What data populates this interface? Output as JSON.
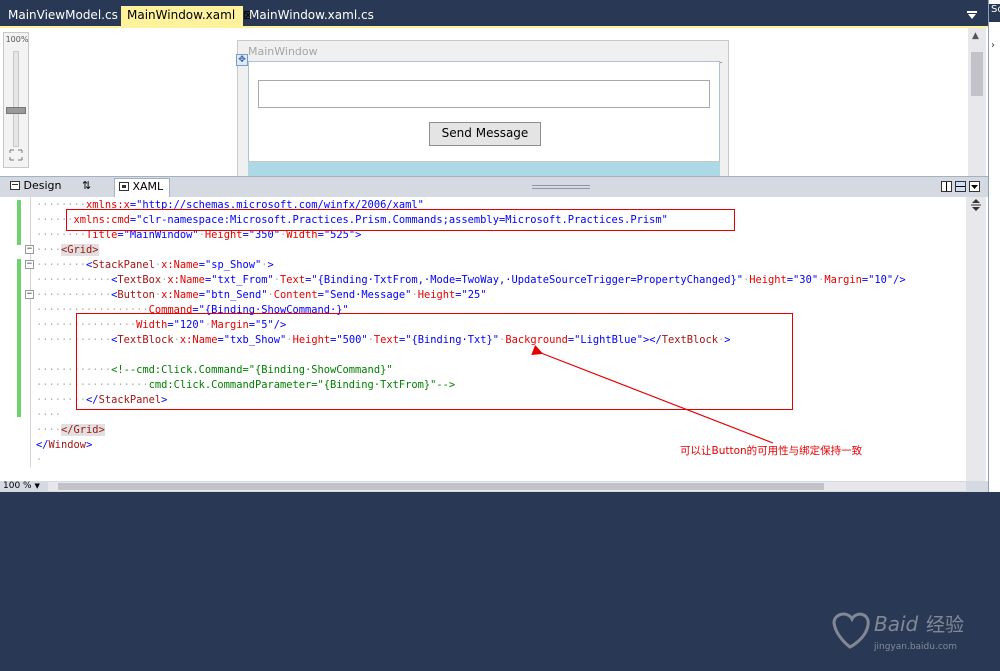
{
  "tabs": [
    {
      "label": "MainViewModel.cs",
      "active": false
    },
    {
      "label": "MainWindow.xaml",
      "active": true,
      "close": "⊠"
    },
    {
      "label": "MainWindow.xaml.cs",
      "active": false
    }
  ],
  "right_panel_label": "So",
  "designer": {
    "zoom_level": "100%",
    "window_title": "MainWindow",
    "button_label": "Send Message",
    "textblock_background": "#add8e6"
  },
  "split_tabs": {
    "design": "Design",
    "swap": "⇅",
    "xaml": "XAML"
  },
  "code_lines": [
    [
      [
        "sp",
        "········"
      ],
      [
        "attr",
        "xmlns:x"
      ],
      [
        "val",
        "=\"http://schemas.microsoft.com/winfx/2006/xaml\""
      ]
    ],
    [
      [
        "sp",
        "······"
      ],
      [
        "attr",
        "xmlns:cmd"
      ],
      [
        "val",
        "=\"clr-namespace:Microsoft.Practices.Prism.Commands;assembly=Microsoft.Practices.Prism\""
      ]
    ],
    [
      [
        "sp",
        "········"
      ],
      [
        "attr",
        "Title"
      ],
      [
        "val",
        "=\"MainWindow\""
      ],
      [
        "sp",
        "·"
      ],
      [
        "attr",
        "Height"
      ],
      [
        "val",
        "=\"350\""
      ],
      [
        "sp",
        "·"
      ],
      [
        "attr",
        "Width"
      ],
      [
        "val",
        "=\"525\">"
      ]
    ],
    [
      [
        "sp",
        "····"
      ],
      [
        "hltag",
        "<Grid>"
      ]
    ],
    [
      [
        "sp",
        "········"
      ],
      [
        "val",
        "<"
      ],
      [
        "tag",
        "StackPanel"
      ],
      [
        "sp",
        "·"
      ],
      [
        "attr",
        "x:Name"
      ],
      [
        "val",
        "=\"sp_Show\""
      ],
      [
        "sp",
        "·"
      ],
      [
        "val",
        ">"
      ]
    ],
    [
      [
        "sp",
        "············"
      ],
      [
        "val",
        "<"
      ],
      [
        "tag",
        "TextBox"
      ],
      [
        "sp",
        "·"
      ],
      [
        "attr",
        "x:Name"
      ],
      [
        "val",
        "=\"txt_From\""
      ],
      [
        "sp",
        "·"
      ],
      [
        "attr",
        "Text"
      ],
      [
        "val",
        "=\"{Binding·TxtFrom,·Mode=TwoWay,·UpdateSourceTrigger=PropertyChanged}\""
      ],
      [
        "sp",
        "·"
      ],
      [
        "attr",
        "Height"
      ],
      [
        "val",
        "=\"30\""
      ],
      [
        "sp",
        "·"
      ],
      [
        "attr",
        "Margin"
      ],
      [
        "val",
        "=\"10\"/>"
      ]
    ],
    [
      [
        "sp",
        "············"
      ],
      [
        "val",
        "<"
      ],
      [
        "tag",
        "Button"
      ],
      [
        "sp",
        "·"
      ],
      [
        "attr",
        "x:Name"
      ],
      [
        "val",
        "=\"btn_Send\""
      ],
      [
        "sp",
        "·"
      ],
      [
        "attr",
        "Content"
      ],
      [
        "val",
        "=\"Send·Message\""
      ],
      [
        "sp",
        "·"
      ],
      [
        "attr",
        "Height"
      ],
      [
        "val",
        "=\"25\""
      ]
    ],
    [
      [
        "sp",
        "··················"
      ],
      [
        "attr",
        "Command"
      ],
      [
        "val",
        "=\"{Binding·ShowCommand·}\""
      ]
    ],
    [
      [
        "sp",
        "················"
      ],
      [
        "attr",
        "Width"
      ],
      [
        "val",
        "=\"120\""
      ],
      [
        "sp",
        "·"
      ],
      [
        "attr",
        "Margin"
      ],
      [
        "val",
        "=\"5\"/>"
      ]
    ],
    [
      [
        "sp",
        "············"
      ],
      [
        "val",
        "<"
      ],
      [
        "tag",
        "TextBlock"
      ],
      [
        "sp",
        "·"
      ],
      [
        "attr",
        "x:Name"
      ],
      [
        "val",
        "=\"txb_Show\""
      ],
      [
        "sp",
        "·"
      ],
      [
        "attr",
        "Height"
      ],
      [
        "val",
        "=\"500\""
      ],
      [
        "sp",
        "·"
      ],
      [
        "attr",
        "Text"
      ],
      [
        "val",
        "=\"{Binding·Txt}\""
      ],
      [
        "sp",
        "·"
      ],
      [
        "attr",
        "Background"
      ],
      [
        "val",
        "=\"LightBlue\"></"
      ],
      [
        "tag",
        "TextBlock"
      ],
      [
        "sp",
        "·"
      ],
      [
        "val",
        ">"
      ]
    ],
    [],
    [
      [
        "sp",
        "············"
      ],
      [
        "cmt",
        "<!--cmd:Click.Command=\"{Binding·ShowCommand}\""
      ]
    ],
    [
      [
        "sp",
        "··················"
      ],
      [
        "cmt",
        "cmd:Click.CommandParameter=\"{Binding·TxtFrom}\"-->"
      ]
    ],
    [
      [
        "sp",
        "········"
      ],
      [
        "val",
        "</"
      ],
      [
        "tag",
        "StackPanel"
      ],
      [
        "val",
        ">"
      ]
    ],
    [
      [
        "sp",
        "····"
      ]
    ],
    [
      [
        "sp",
        "····"
      ],
      [
        "hltag",
        "</Grid>"
      ]
    ],
    [
      [
        "val",
        "</"
      ],
      [
        "tag",
        "Window"
      ],
      [
        "val",
        ">"
      ]
    ],
    [
      [
        "sp",
        "·"
      ]
    ]
  ],
  "annotation_note": "可以让Button的可用性与绑定保持一致",
  "bottom": {
    "zoom": "100 %"
  },
  "watermark": {
    "brand": "Baidu",
    "brand_cn": "经验",
    "sub": "jingyan.baidu.com"
  },
  "colors": {
    "accent_tab": "#fff29d",
    "chrome_dark": "#293955",
    "annotation": "#e60000",
    "change_bar": "#6ed36e"
  }
}
